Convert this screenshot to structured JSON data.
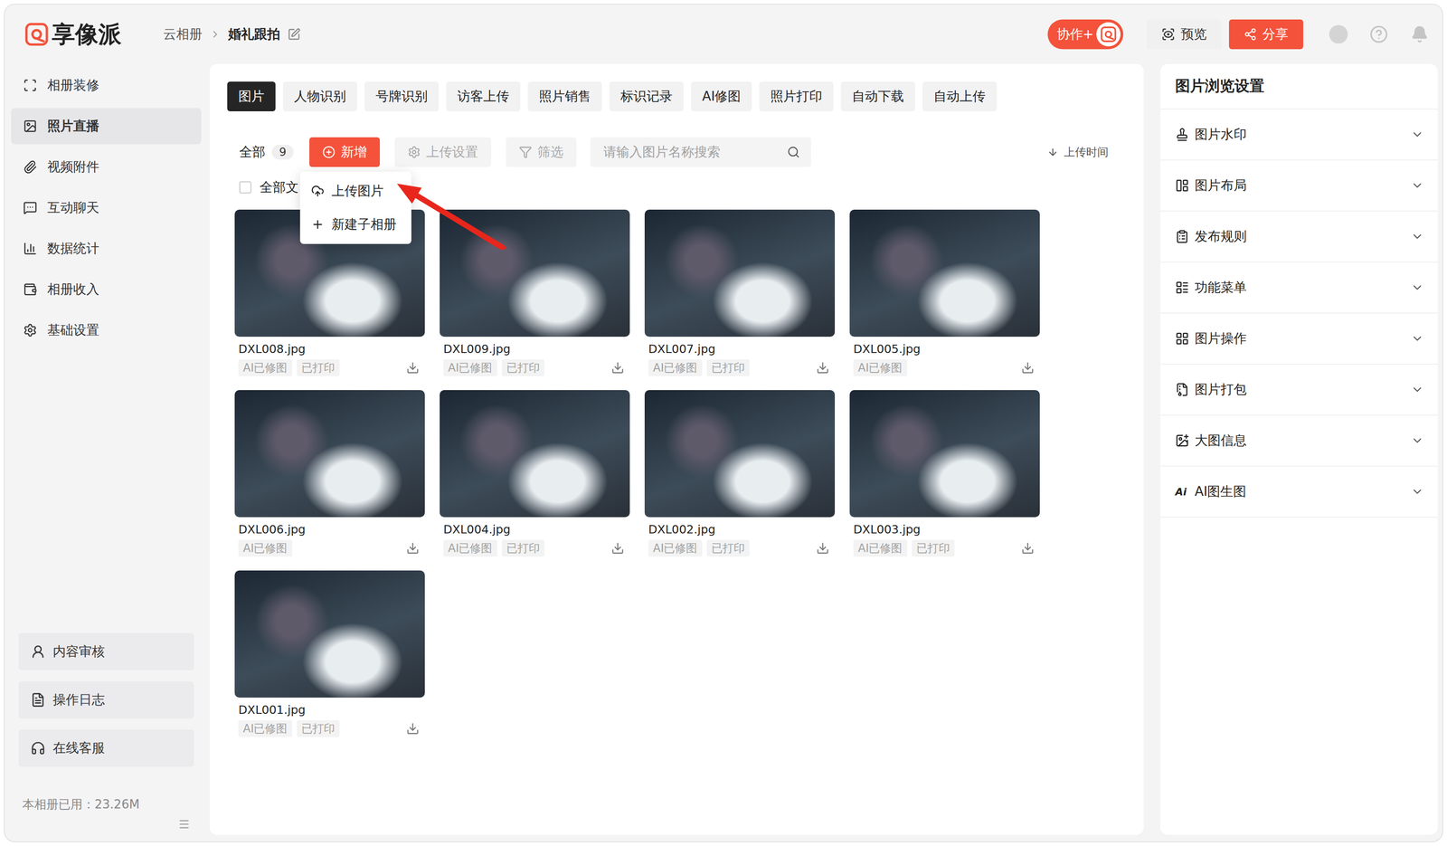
{
  "app": {
    "logo": "享像派"
  },
  "breadcrumb": [
    {
      "label": "云相册",
      "current": false
    },
    {
      "label": "婚礼跟拍",
      "current": true
    }
  ],
  "header": {
    "collab": "协作+",
    "preview": "预览",
    "share": "分享"
  },
  "sidebar": {
    "items": [
      {
        "label": "相册装修",
        "selected": false
      },
      {
        "label": "照片直播",
        "selected": true
      },
      {
        "label": "视频附件",
        "selected": false
      },
      {
        "label": "互动聊天",
        "selected": false
      },
      {
        "label": "数据统计",
        "selected": false
      },
      {
        "label": "相册收入",
        "selected": false
      },
      {
        "label": "基础设置",
        "selected": false
      }
    ],
    "bottom": [
      "内容审核",
      "操作日志",
      "在线客服"
    ],
    "usage": "本相册已用：23.26M"
  },
  "tabs": [
    {
      "label": "图片",
      "selected": true
    },
    {
      "label": "人物识别",
      "selected": false
    },
    {
      "label": "号牌识别",
      "selected": false
    },
    {
      "label": "访客上传",
      "selected": false
    },
    {
      "label": "照片销售",
      "selected": false
    },
    {
      "label": "标识记录",
      "selected": false
    },
    {
      "label": "AI修图",
      "selected": false
    },
    {
      "label": "照片打印",
      "selected": false
    },
    {
      "label": "自动下载",
      "selected": false
    },
    {
      "label": "自动上传",
      "selected": false
    }
  ],
  "toolbar": {
    "all": "全部",
    "count": "9",
    "new": "新增",
    "upload_settings": "上传设置",
    "filter": "筛选",
    "search_placeholder": "请输入图片名称搜索",
    "sort": "上传时间"
  },
  "select_all": {
    "label": "全部文",
    "checked": false
  },
  "menu": {
    "open": true,
    "items": [
      "上传图片",
      "新建子相册"
    ]
  },
  "photos": [
    {
      "name": "DXL008.jpg",
      "tags": [
        "AI已修图",
        "已打印"
      ]
    },
    {
      "name": "DXL009.jpg",
      "tags": [
        "AI已修图",
        "已打印"
      ]
    },
    {
      "name": "DXL007.jpg",
      "tags": [
        "AI已修图",
        "已打印"
      ]
    },
    {
      "name": "DXL005.jpg",
      "tags": [
        "AI已修图"
      ]
    },
    {
      "name": "DXL006.jpg",
      "tags": [
        "AI已修图"
      ]
    },
    {
      "name": "DXL004.jpg",
      "tags": [
        "AI已修图",
        "已打印"
      ]
    },
    {
      "name": "DXL002.jpg",
      "tags": [
        "AI已修图",
        "已打印"
      ]
    },
    {
      "name": "DXL003.jpg",
      "tags": [
        "AI已修图",
        "已打印"
      ]
    },
    {
      "name": "DXL001.jpg",
      "tags": [
        "AI已修图",
        "已打印"
      ]
    }
  ],
  "settings": {
    "title": "图片浏览设置",
    "items": [
      {
        "label": "图片水印",
        "expanded": false
      },
      {
        "label": "图片布局",
        "expanded": false
      },
      {
        "label": "发布规则",
        "expanded": false
      },
      {
        "label": "功能菜单",
        "expanded": false
      },
      {
        "label": "图片操作",
        "expanded": false
      },
      {
        "label": "图片打包",
        "expanded": false
      },
      {
        "label": "大图信息",
        "expanded": false
      },
      {
        "label": "AI图生图",
        "icon_text": "Ai",
        "expanded": false
      }
    ]
  }
}
